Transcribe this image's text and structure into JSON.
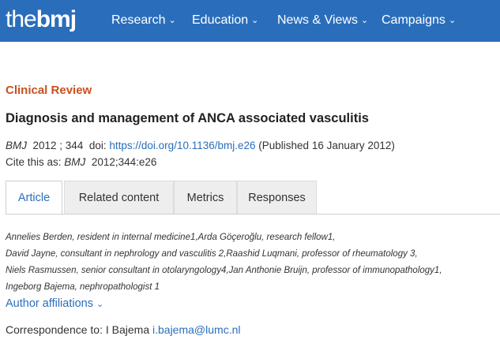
{
  "header": {
    "logo_the": "the",
    "logo_bmj": "bmj",
    "nav": [
      {
        "label": "Research"
      },
      {
        "label": "Education"
      },
      {
        "label": "News & Views"
      },
      {
        "label": "Campaigns"
      }
    ],
    "chevron_icon": "chevron-down-icon",
    "colors": {
      "bar": "#2a6ebb"
    }
  },
  "article": {
    "category": "Clinical Review",
    "title": "Diagnosis and management of ANCA associated vasculitis",
    "journal": "BMJ",
    "year_volume": "2012 ; 344",
    "doi_label": "doi:",
    "doi_link": "https://doi.org/10.1136/bmj.e26",
    "published": "(Published 16 January 2012)",
    "cite_label": "Cite this as:",
    "cite_journal": "BMJ",
    "cite_ref": "2012;344:e26",
    "accent_color": "#c8501e"
  },
  "tabs": [
    {
      "label": "Article",
      "active": true
    },
    {
      "label": "Related content",
      "active": false
    },
    {
      "label": "Metrics",
      "active": false
    },
    {
      "label": "Responses",
      "active": false
    }
  ],
  "authors": [
    "Annelies Berden, resident in internal medicine1,Arda Göçeroğlu, research fellow1,",
    "David Jayne, consultant in nephrology and vasculitis 2,Raashid Luqmani, professor of rheumatology 3,",
    "Niels Rasmussen, senior consultant in otolaryngology4,Jan Anthonie Bruijn, professor of immunopathology1,",
    "Ingeborg Bajema, nephropathologist 1"
  ],
  "affiliations_label": "Author affiliations",
  "correspondence": {
    "label": "Correspondence to: I Bajema",
    "email": "i.bajema@lumc.nl"
  }
}
